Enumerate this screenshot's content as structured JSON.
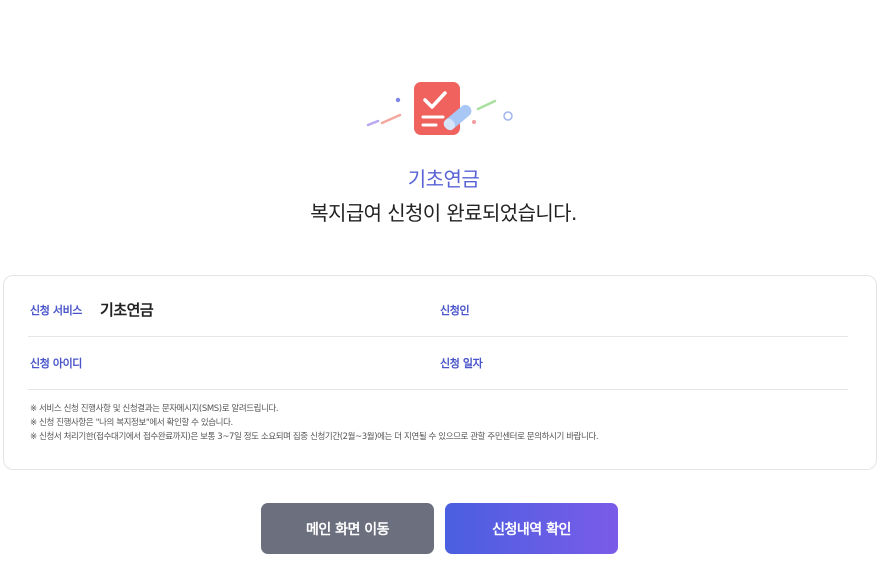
{
  "hero": {
    "icon": "checklist-pencil-icon",
    "service_title": "기초연금",
    "complete_message": "복지급여 신청이 완료되었습니다."
  },
  "details": {
    "service_label": "신청 서비스",
    "service_value": "기초연금",
    "applicant_label": "신청인",
    "applicant_value": "",
    "user_id_label": "신청 아이디",
    "user_id_value": "",
    "date_label": "신청 일자",
    "date_value": ""
  },
  "notes": [
    "※ 서비스 신청 진행사항 및 신청결과는 문자메시지(SMS)로 알려드립니다.",
    "※ 신청 진행사항은 \"나의 복지정보\"에서 확인할 수 있습니다.",
    "※ 신청서 처리기한(접수대기에서 접수완료까지)은 보통 3~7일 정도 소요되며 집중 신청기간(2월~3월)에는 더 지연될 수 있으므로 관할 주민센터로 문의하시기 바랍니다."
  ],
  "buttons": {
    "main_label": "메인 화면 이동",
    "history_label": "신청내역 확인"
  },
  "colors": {
    "accent": "#5a63d6",
    "button_gray": "#6c6f7e",
    "button_gradient_start": "#4a5fe0",
    "button_gradient_end": "#7a5ce8",
    "icon_red": "#f0625e"
  }
}
